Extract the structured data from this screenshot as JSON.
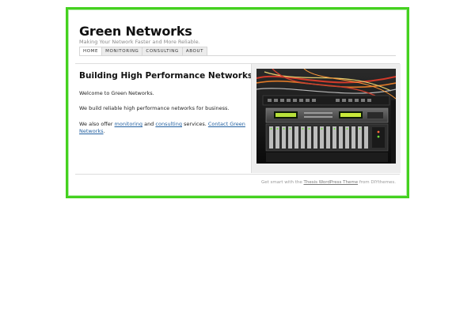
{
  "site": {
    "title": "Green Networks",
    "tagline": "Making Your Network Faster and More Reliable."
  },
  "nav": [
    {
      "label": "HOME",
      "active": true
    },
    {
      "label": "MONITORING",
      "active": false
    },
    {
      "label": "CONSULTING",
      "active": false
    },
    {
      "label": "ABOUT",
      "active": false
    }
  ],
  "main": {
    "headline": "Building High Performance Networks",
    "welcome": "Welcome to Green Networks.",
    "reliable": "We build reliable high performance networks for business.",
    "offer_prefix": "We also offer ",
    "monitoring_link": "monitoring",
    "and_text": " and ",
    "consulting_link": "consulting",
    "services_text": " services.  ",
    "contact_link": "Contact Green Networks",
    "period": "."
  },
  "sidebar": {
    "image_icon": "network-rack-photo"
  },
  "footer": {
    "prefix": "Get smart with the ",
    "theme_link": "Thesis WordPress Theme",
    "suffix": " from DIYthemes."
  },
  "colors": {
    "frame_border": "#44d11f",
    "link": "#2361a1",
    "nav_bg": "#ececec"
  }
}
